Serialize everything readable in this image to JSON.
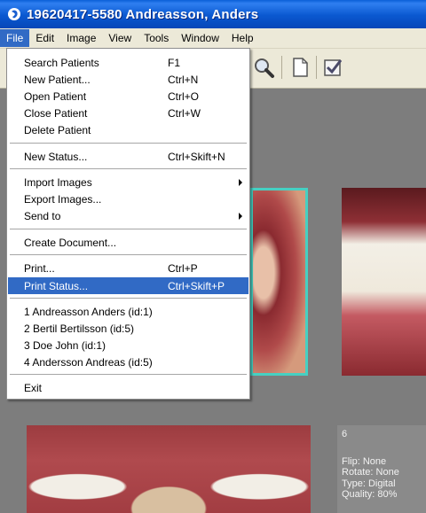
{
  "window": {
    "title": "19620417-5580 Andreasson, Anders"
  },
  "menubar": [
    {
      "label": "File",
      "active": true
    },
    {
      "label": "Edit"
    },
    {
      "label": "Image"
    },
    {
      "label": "View"
    },
    {
      "label": "Tools"
    },
    {
      "label": "Window"
    },
    {
      "label": "Help"
    }
  ],
  "file_menu": {
    "items": [
      {
        "label": "Search Patients",
        "shortcut": "F1"
      },
      {
        "label": "New Patient...",
        "shortcut": "Ctrl+N"
      },
      {
        "label": "Open Patient",
        "shortcut": "Ctrl+O"
      },
      {
        "label": "Close Patient",
        "shortcut": "Ctrl+W"
      },
      {
        "label": "Delete Patient",
        "shortcut": ""
      },
      {
        "label": "New Status...",
        "shortcut": "Ctrl+Skift+N"
      },
      {
        "label": "Import Images",
        "shortcut": "",
        "submenu": true
      },
      {
        "label": "Export Images...",
        "shortcut": ""
      },
      {
        "label": "Send to",
        "shortcut": "",
        "submenu": true
      },
      {
        "label": "Create Document...",
        "shortcut": ""
      },
      {
        "label": "Print...",
        "shortcut": "Ctrl+P"
      },
      {
        "label": "Print Status...",
        "shortcut": "Ctrl+Skift+P",
        "highlighted": true
      },
      {
        "label": "1 Andreasson Anders (id:1)",
        "shortcut": ""
      },
      {
        "label": "2 Bertil Bertilsson (id:5)",
        "shortcut": ""
      },
      {
        "label": "3 Doe John (id:1)",
        "shortcut": ""
      },
      {
        "label": "4 Andersson Andreas (id:5)",
        "shortcut": ""
      },
      {
        "label": "Exit",
        "shortcut": ""
      }
    ]
  },
  "image_info": {
    "number": "6",
    "flip": "Flip: None",
    "rotate": "Rotate: None",
    "type": "Type: Digital",
    "quality": "Quality: 80%"
  },
  "colors": {
    "title_bar": "#0a58d0",
    "menu_highlight": "#316ac5",
    "selection_border": "#46d0c2"
  }
}
